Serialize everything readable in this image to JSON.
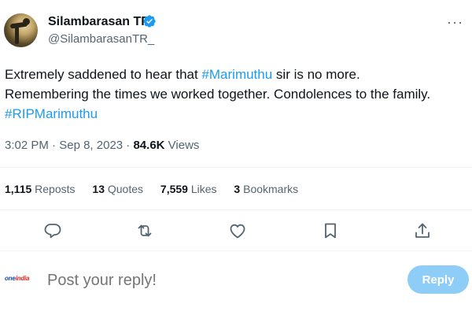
{
  "author": {
    "display_name": "Silambarasan TR",
    "handle": "@SilambarasanTR_",
    "verified": true
  },
  "tweet": {
    "line1_prefix": "Extremely saddened to hear that ",
    "line1_hashtag": "#Marimuthu",
    "line1_suffix": " sir is no more.",
    "line2": "Remembering the times we worked together. Condolences to the family.",
    "line3_hashtag": "#RIPMarimuthu"
  },
  "meta": {
    "time": "3:02 PM",
    "date": "Sep 8, 2023",
    "separator": "·",
    "views_count": "84.6K",
    "views_label": "Views"
  },
  "stats": {
    "reposts_count": "1,115",
    "reposts_label": "Reposts",
    "quotes_count": "13",
    "quotes_label": "Quotes",
    "likes_count": "7,559",
    "likes_label": "Likes",
    "bookmarks_count": "3",
    "bookmarks_label": "Bookmarks"
  },
  "reply": {
    "placeholder": "Post your reply!",
    "button_label": "Reply",
    "logo_text_a": "one",
    "logo_text_b": "india"
  },
  "colors": {
    "accent": "#1d9bf0",
    "reply_button": "#8ecdf8",
    "secondary_text": "#536471"
  },
  "icons": [
    "verified-badge-icon",
    "more-icon",
    "reply-icon",
    "repost-icon",
    "like-icon",
    "bookmark-icon",
    "share-icon"
  ]
}
